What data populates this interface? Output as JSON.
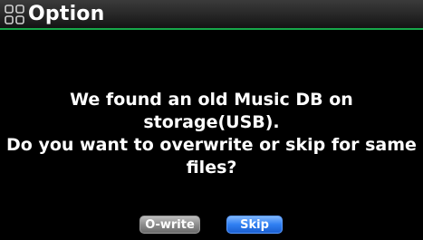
{
  "header": {
    "title": "Option",
    "icon": "grid-menu-icon"
  },
  "dialog": {
    "message": "We found an old Music DB on storage(USB).\nDo you want to overwrite or skip for same\nfiles?"
  },
  "buttons": {
    "overwrite_label": "O-write",
    "skip_label": "Skip"
  },
  "colors": {
    "background": "#000000",
    "title_underline": "#17a84a",
    "skip_button": "#2f7ff2",
    "overwrite_button": "#8d8d8d"
  }
}
